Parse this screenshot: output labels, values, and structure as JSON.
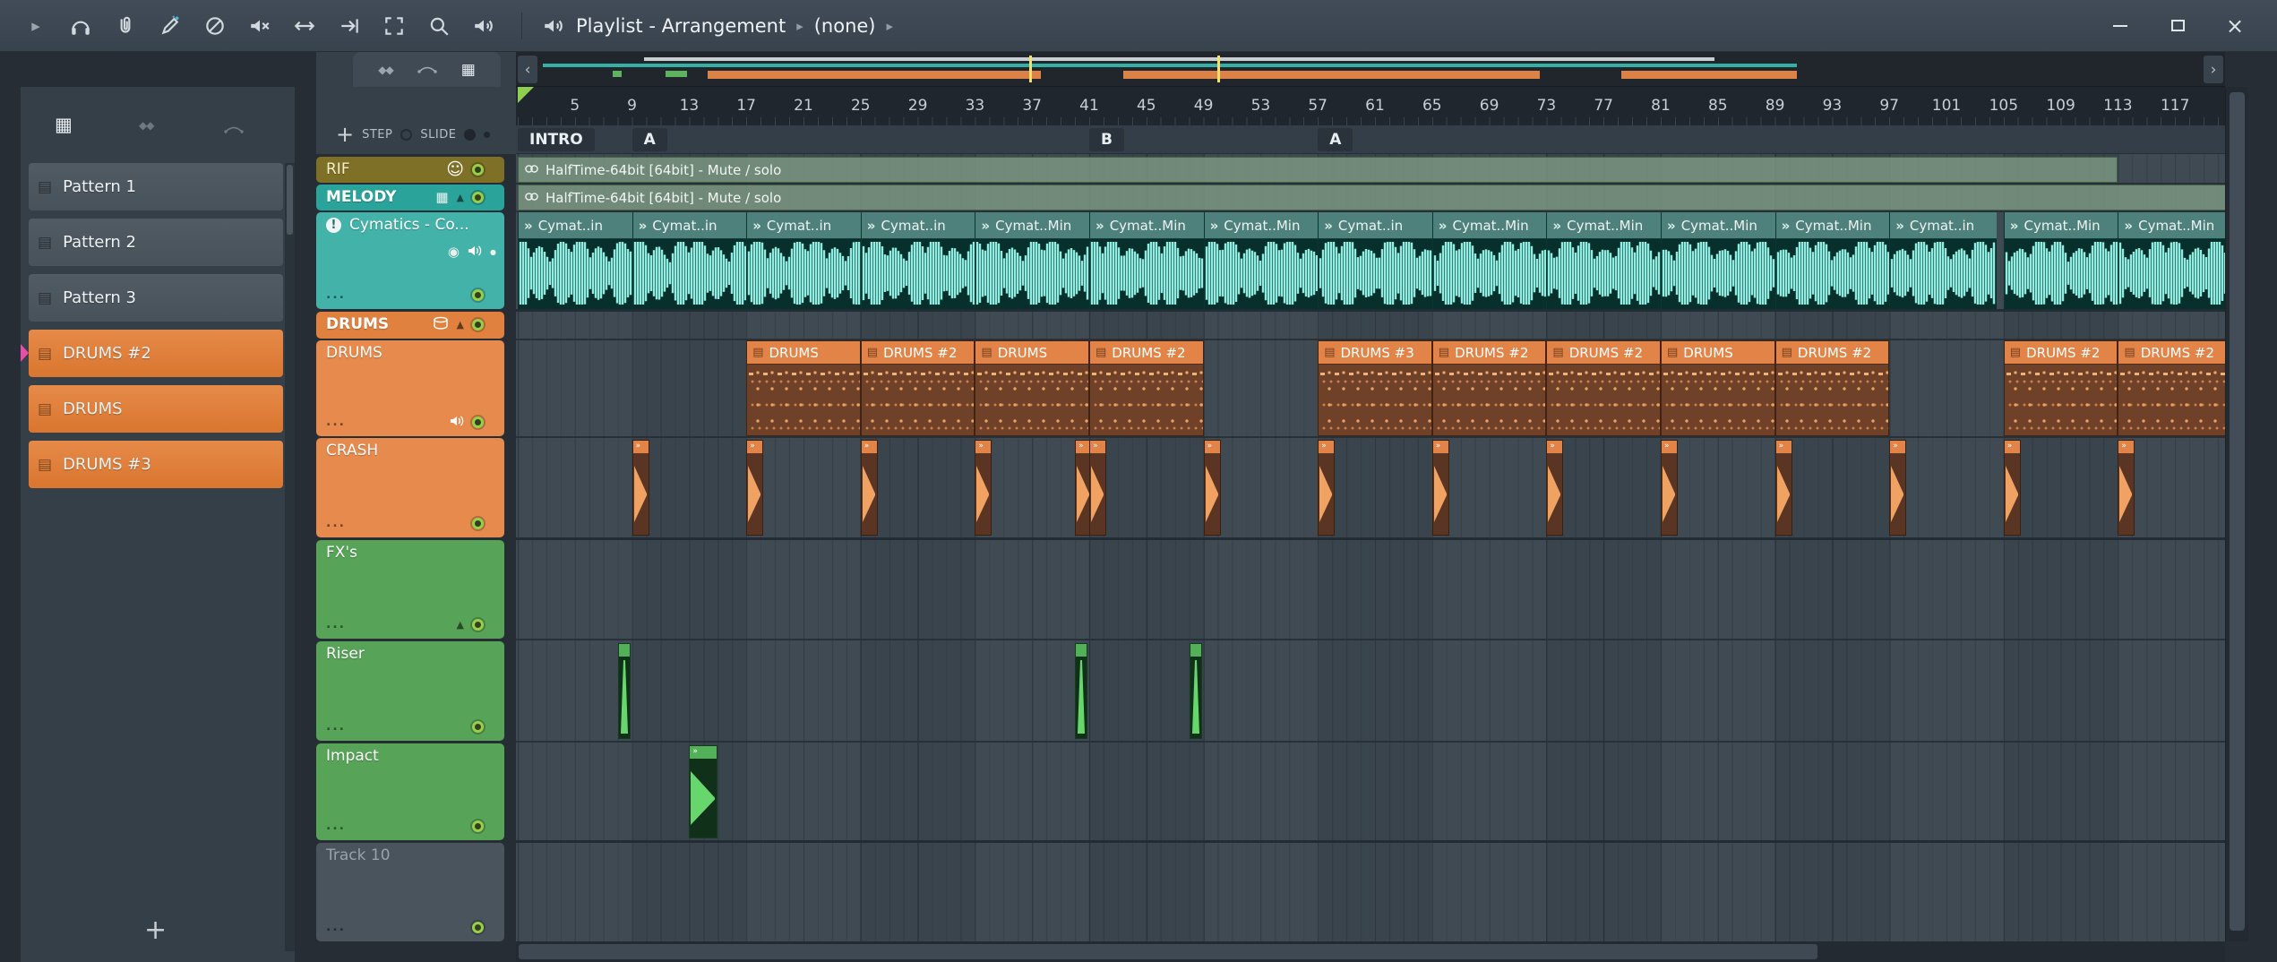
{
  "window": {
    "title": "Playlist - Arrangement",
    "context": "(none)",
    "toolbar_icons": [
      "menu-arrow",
      "headphones",
      "paperclip",
      "draw",
      "disable",
      "mute",
      "pan",
      "slide",
      "select",
      "zoom",
      "preview-speaker"
    ],
    "window_buttons": [
      "minimize",
      "maximize",
      "close"
    ]
  },
  "pattern_panel": {
    "patterns": [
      {
        "label": "Pattern 1",
        "color": "gray"
      },
      {
        "label": "Pattern 2",
        "color": "gray"
      },
      {
        "label": "Pattern 3",
        "color": "gray"
      },
      {
        "label": "DRUMS #2",
        "color": "orange",
        "selected": true
      },
      {
        "label": "DRUMS",
        "color": "orange"
      },
      {
        "label": "DRUMS #3",
        "color": "orange"
      }
    ],
    "add_button": "+"
  },
  "track_tools": {
    "add_button": "+",
    "step_label": "STEP",
    "slide_label": "SLIDE"
  },
  "timeline": {
    "bar_numbers": [
      5,
      9,
      13,
      17,
      21,
      25,
      29,
      33,
      37,
      41,
      45,
      49,
      53,
      57,
      61,
      65,
      69,
      73,
      77,
      81,
      85,
      89,
      93,
      97,
      101,
      105,
      109,
      113,
      117
    ],
    "sections": [
      {
        "label": "INTRO",
        "bar": 1
      },
      {
        "label": "A",
        "bar": 9
      },
      {
        "label": "B",
        "bar": 41
      },
      {
        "label": "A",
        "bar": 57
      }
    ]
  },
  "tracks": [
    {
      "name": "RIF",
      "type": "single",
      "color": "#7e7026"
    },
    {
      "name": "MELODY",
      "type": "group-header",
      "color": "#2aa49a"
    },
    {
      "name": "Cymatics - Co...",
      "type": "audio-child",
      "color": "#43b3a9"
    },
    {
      "name": "DRUMS",
      "type": "group-header",
      "color": "#e0813f"
    },
    {
      "name": "DRUMS",
      "type": "child",
      "color": "#e68a4d"
    },
    {
      "name": "CRASH",
      "type": "child",
      "color": "#e68a4d"
    },
    {
      "name": "FX's",
      "type": "child",
      "color": "#57a458"
    },
    {
      "name": "Riser",
      "type": "child",
      "color": "#57a458"
    },
    {
      "name": "Impact",
      "type": "child",
      "color": "#57a458"
    },
    {
      "name": "Track 10",
      "type": "empty",
      "color": "#4a545d"
    }
  ],
  "clips": {
    "automation_strips": [
      {
        "label": "HalfTime-64bit [64bit] - Mute / solo",
        "lane": "rif",
        "start": 1,
        "length": 112
      },
      {
        "label": "HalfTime-64bit [64bit] - Mute / solo",
        "lane": "melody",
        "start": 1,
        "length": 120
      }
    ],
    "melody_audio": [
      {
        "label": "Cymat..in",
        "start": 1,
        "length": 8
      },
      {
        "label": "Cymat..in",
        "start": 9,
        "length": 8
      },
      {
        "label": "Cymat..in",
        "start": 17,
        "length": 8
      },
      {
        "label": "Cymat..in",
        "start": 25,
        "length": 8
      },
      {
        "label": "Cymat..Min",
        "start": 33,
        "length": 8
      },
      {
        "label": "Cymat..Min",
        "start": 41,
        "length": 8
      },
      {
        "label": "Cymat..Min",
        "start": 49,
        "length": 8
      },
      {
        "label": "Cymat..in",
        "start": 57,
        "length": 8
      },
      {
        "label": "Cymat..Min",
        "start": 65,
        "length": 8
      },
      {
        "label": "Cymat..Min",
        "start": 73,
        "length": 8
      },
      {
        "label": "Cymat..Min",
        "start": 81,
        "length": 8
      },
      {
        "label": "Cymat..Min",
        "start": 89,
        "length": 8
      },
      {
        "label": "Cymat..in",
        "start": 97,
        "length": 7.5
      },
      {
        "label": "Cymat..Min",
        "start": 105,
        "length": 8
      },
      {
        "label": "Cymat..Min",
        "start": 113,
        "length": 8
      }
    ],
    "drum_patterns": [
      {
        "label": "DRUMS",
        "start": 17,
        "length": 8
      },
      {
        "label": "DRUMS #2",
        "start": 25,
        "length": 8
      },
      {
        "label": "DRUMS",
        "start": 33,
        "length": 8
      },
      {
        "label": "DRUMS #2",
        "start": 41,
        "length": 8
      },
      {
        "label": "DRUMS #3",
        "start": 57,
        "length": 8
      },
      {
        "label": "DRUMS #2",
        "start": 65,
        "length": 8
      },
      {
        "label": "DRUMS #2",
        "start": 73,
        "length": 8
      },
      {
        "label": "DRUMS",
        "start": 81,
        "length": 8
      },
      {
        "label": "DRUMS #2",
        "start": 89,
        "length": 8
      },
      {
        "label": "DRUMS #2",
        "start": 105,
        "length": 8
      },
      {
        "label": "DRUMS #2",
        "start": 113,
        "length": 8
      }
    ],
    "crash_hits": [
      9,
      17,
      25,
      33,
      40,
      41,
      49,
      57,
      65,
      73,
      81,
      89,
      97,
      105,
      113
    ],
    "riser_hits": [
      8,
      40,
      48
    ],
    "impact_hits": [
      {
        "start": 13,
        "length": 2
      }
    ]
  },
  "colors": {
    "led_green": "#9fd24c",
    "audio_wave": "#8feee1",
    "crash_wave": "#efa261",
    "green_wave": "#67d66d",
    "selected_pattern_marker": "#e84da8"
  }
}
